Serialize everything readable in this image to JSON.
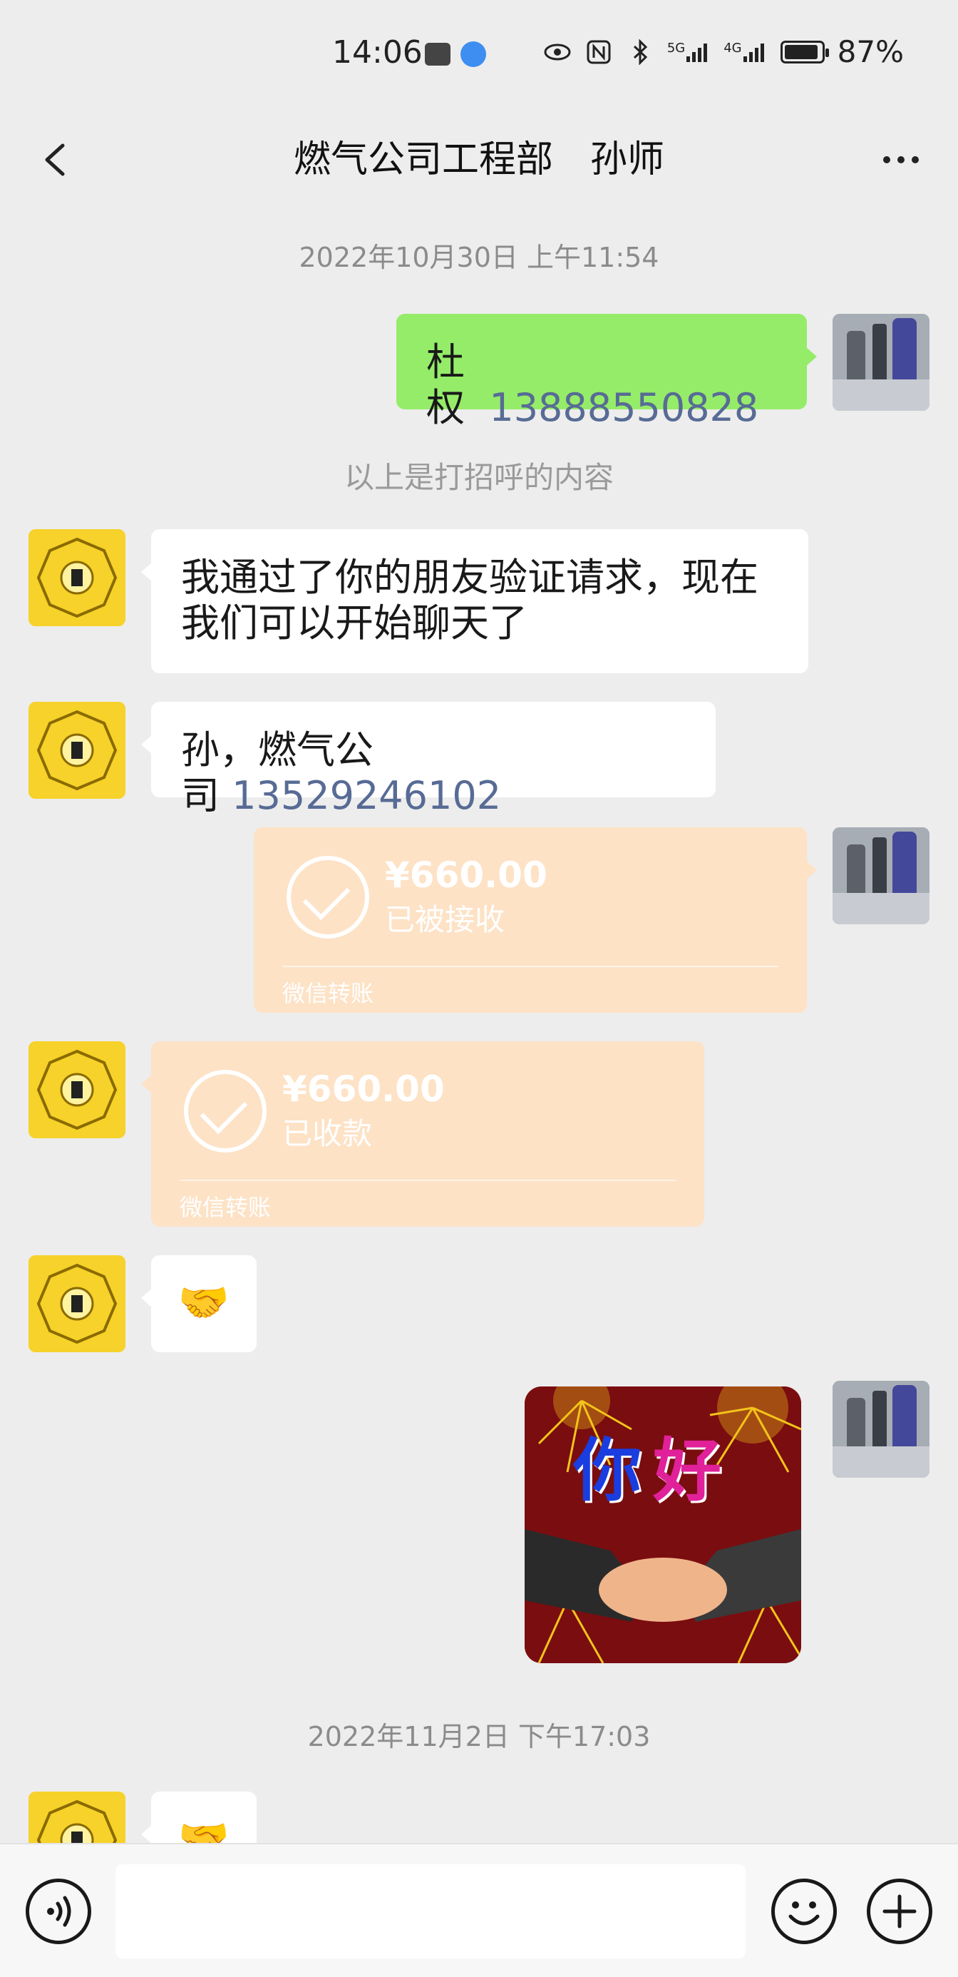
{
  "status_bar": {
    "time": "14:06",
    "network_labels": [
      "5G",
      "4G"
    ],
    "battery": "87%",
    "icons": [
      "huawei-appgallery-icon",
      "browser-icon",
      "eye-icon",
      "nfc-icon",
      "bluetooth-icon",
      "signal-5g-icon",
      "signal-4g-icon",
      "battery-icon"
    ]
  },
  "header": {
    "title": "燃气公司工程部　孙师",
    "back_icon": "chevron-left-icon",
    "more_icon": "more-dots-icon"
  },
  "messages": {
    "ts1": "2022年10月30日 上午11:54",
    "m1": {
      "sender": "me",
      "name": "杜权",
      "phone": "13888550828"
    },
    "sys1": "以上是打招呼的内容",
    "m2": {
      "sender": "other",
      "line1": "我通过了你的朋友验证请求，现在",
      "line2": "我们可以开始聊天了"
    },
    "m3": {
      "sender": "other",
      "text": "孙，燃气公司",
      "phone": "13529246102"
    },
    "m4": {
      "sender": "me",
      "amount": "¥660.00",
      "status": "已被接收",
      "label": "微信转账"
    },
    "m5": {
      "sender": "other",
      "amount": "¥660.00",
      "status": "已收款",
      "label": "微信转账"
    },
    "m6": {
      "sender": "other",
      "emoji": "🤝"
    },
    "m7": {
      "sender": "me",
      "sticker_text_1": "你",
      "sticker_text_2": "好"
    },
    "ts2": "2022年11月2日 下午17:03",
    "m8": {
      "sender": "other",
      "emoji": "🤝"
    }
  },
  "input_bar": {
    "value": "",
    "icons": [
      "voice-icon",
      "emoji-icon",
      "plus-icon"
    ]
  },
  "colors": {
    "background": "#ededed",
    "my_bubble": "#95ec69",
    "other_bubble": "#ffffff",
    "transfer_card": "#fde2c6",
    "link": "#576b95"
  }
}
